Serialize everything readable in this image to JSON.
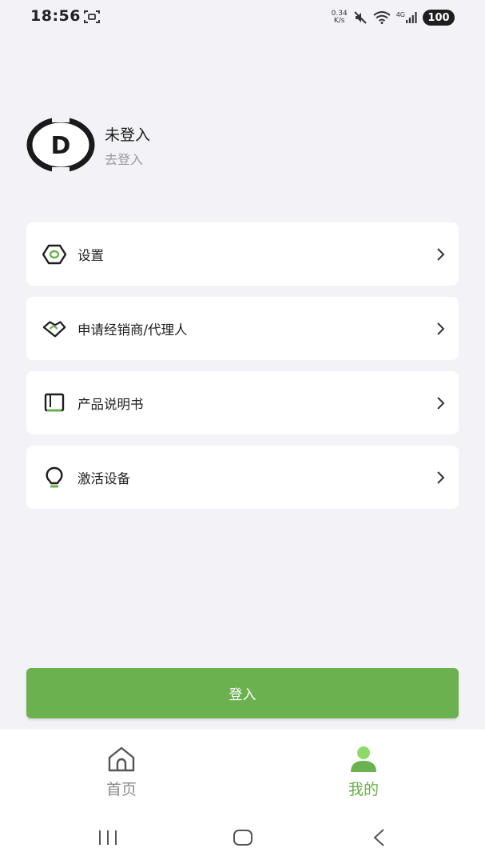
{
  "status_bar": {
    "time": "18:56",
    "net_speed_value": "0.34",
    "net_speed_unit": "K/s",
    "network_type": "4G",
    "battery": "100"
  },
  "profile": {
    "name": "未登入",
    "subtitle": "去登入",
    "avatar_letter": "D"
  },
  "menu": {
    "items": [
      {
        "label": "设置",
        "icon": "settings-hexagon-icon"
      },
      {
        "label": "申请经销商/代理人",
        "icon": "handshake-icon"
      },
      {
        "label": "产品说明书",
        "icon": "book-icon"
      },
      {
        "label": "激活设备",
        "icon": "lightbulb-icon"
      }
    ]
  },
  "login_button": {
    "label": "登入"
  },
  "tab_bar": {
    "tabs": [
      {
        "label": "首页",
        "icon": "home-icon",
        "active": false
      },
      {
        "label": "我的",
        "icon": "person-icon",
        "active": true
      }
    ]
  },
  "colors": {
    "accent": "#6bb14f",
    "background": "#f3f3f7",
    "card": "#ffffff",
    "active_tab": "#64b042",
    "inactive_tab": "#8a8a8a"
  }
}
